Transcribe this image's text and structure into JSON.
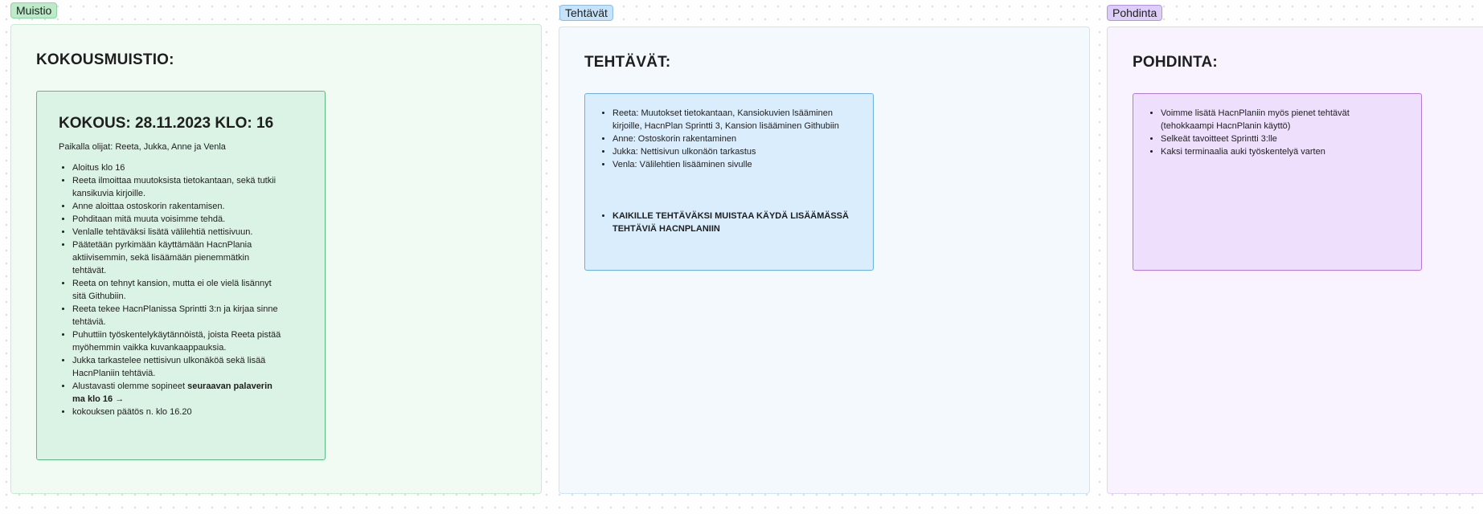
{
  "sections": {
    "muistio": {
      "tag": "Muistio",
      "heading": "KOKOUSMUISTIO:",
      "note": {
        "title": "KOKOUS: 28.11.2023 KLO: 16",
        "attendees": "Paikalla olijat: Reeta, Jukka, Anne ja Venla",
        "items": [
          "Aloitus klo 16",
          "Reeta ilmoittaa muutoksista tietokantaan, sekä tutkii kansikuvia kirjoille.",
          "Anne aloittaa ostoskorin rakentamisen.",
          "Pohditaan mitä muuta voisimme tehdä.",
          "Venlalle tehtäväksi lisätä välilehtiä nettisivuun.",
          "Päätetään pyrkimään käyttämään HacnPlania aktiivisemmin, sekä lisäämään pienemmätkin tehtävät.",
          "Reeta on tehnyt kansion, mutta ei ole vielä lisännyt sitä Githubiin.",
          "Reeta tekee HacnPlanissa Sprintti 3:n ja kirjaa sinne tehtäviä.",
          "Puhuttiin työskentelykäytännöistä, joista Reeta pistää myöhemmin vaikka kuvankaappauksia.",
          "Jukka tarkastelee nettisivun ulkonäköä sekä lisää HacnPlaniin tehtäviä."
        ],
        "next_meeting_prefix": "Alustavasti olemme sopineet ",
        "next_meeting_bold": "seuraavan palaverin ma klo 16 →",
        "closing": "kokouksen päätös n. klo 16.20"
      }
    },
    "tehtavat": {
      "tag": "Tehtävät",
      "heading": "TEHTÄVÄT:",
      "note": {
        "items": [
          "Reeta: Muutokset tietokantaan, Kansiokuvien lsääminen kirjoille, HacnPlan Sprintti 3, Kansion lisääminen Githubiin",
          "Anne: Ostoskorin rakentaminen",
          "Jukka: Nettisivun ulkonäön tarkastus",
          "Venla: Välilehtien lisääminen sivulle"
        ],
        "reminder": "KAIKILLE TEHTÄVÄKSI MUISTAA KÄYDÄ LISÄÄMÄSSÄ TEHTÄVIÄ HACNPLANIIN"
      }
    },
    "pohdinta": {
      "tag": "Pohdinta",
      "heading": "POHDINTA:",
      "note": {
        "items": [
          "Voimme lisätä HacnPlaniin myös pienet tehtävät (tehokkaampi HacnPlanin käyttö)",
          "Selkeät tavoitteet Sprintti 3:lle",
          "Kaksi terminaalia auki työskentelyä varten"
        ]
      }
    }
  },
  "colors": {
    "muistio_accent": "#5fb783",
    "tehtavat_accent": "#6cb1de",
    "pohdinta_accent": "#b57ad6"
  }
}
